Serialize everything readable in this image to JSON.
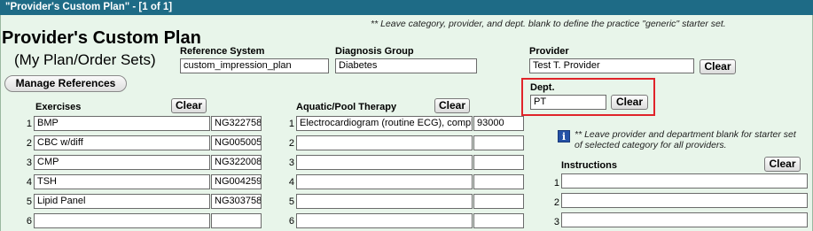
{
  "window": {
    "title": "\"Provider's Custom Plan\" - [1 of 1]"
  },
  "top_note": "** Leave category, provider, and dept. blank to define the practice \"generic\" starter set.",
  "heading": {
    "title": "Provider's Custom Plan",
    "subtitle": "(My Plan/Order Sets)"
  },
  "manage_references_label": "Manage References",
  "reference_system": {
    "label": "Reference System",
    "value": "custom_impression_plan"
  },
  "diagnosis_group": {
    "label": "Diagnosis Group",
    "value": "Diabetes"
  },
  "provider": {
    "label": "Provider",
    "value": "Test T. Provider",
    "clear_label": "Clear"
  },
  "dept": {
    "label": "Dept.",
    "value": "PT",
    "clear_label": "Clear"
  },
  "exercises": {
    "header": "Exercises",
    "clear_label": "Clear",
    "rows": [
      {
        "num": "1",
        "name": "BMP",
        "code": "NG322758"
      },
      {
        "num": "2",
        "name": "CBC w/diff",
        "code": "NG005005"
      },
      {
        "num": "3",
        "name": "CMP",
        "code": "NG322008"
      },
      {
        "num": "4",
        "name": "TSH",
        "code": "NG004259"
      },
      {
        "num": "5",
        "name": "Lipid Panel",
        "code": "NG303758"
      },
      {
        "num": "6",
        "name": "",
        "code": ""
      }
    ]
  },
  "aquatic": {
    "header": "Aquatic/Pool Therapy",
    "clear_label": "Clear",
    "rows": [
      {
        "num": "1",
        "name": "Electrocardiogram (routine ECG), complete",
        "code": "93000"
      },
      {
        "num": "2",
        "name": "",
        "code": ""
      },
      {
        "num": "3",
        "name": "",
        "code": ""
      },
      {
        "num": "4",
        "name": "",
        "code": ""
      },
      {
        "num": "5",
        "name": "",
        "code": ""
      },
      {
        "num": "6",
        "name": "",
        "code": ""
      }
    ]
  },
  "side_note": "** Leave provider and department blank for starter set of selected category for all providers.",
  "instructions": {
    "header": "Instructions",
    "clear_label": "Clear",
    "rows": [
      {
        "num": "1",
        "value": ""
      },
      {
        "num": "2",
        "value": ""
      },
      {
        "num": "3",
        "value": ""
      }
    ]
  }
}
